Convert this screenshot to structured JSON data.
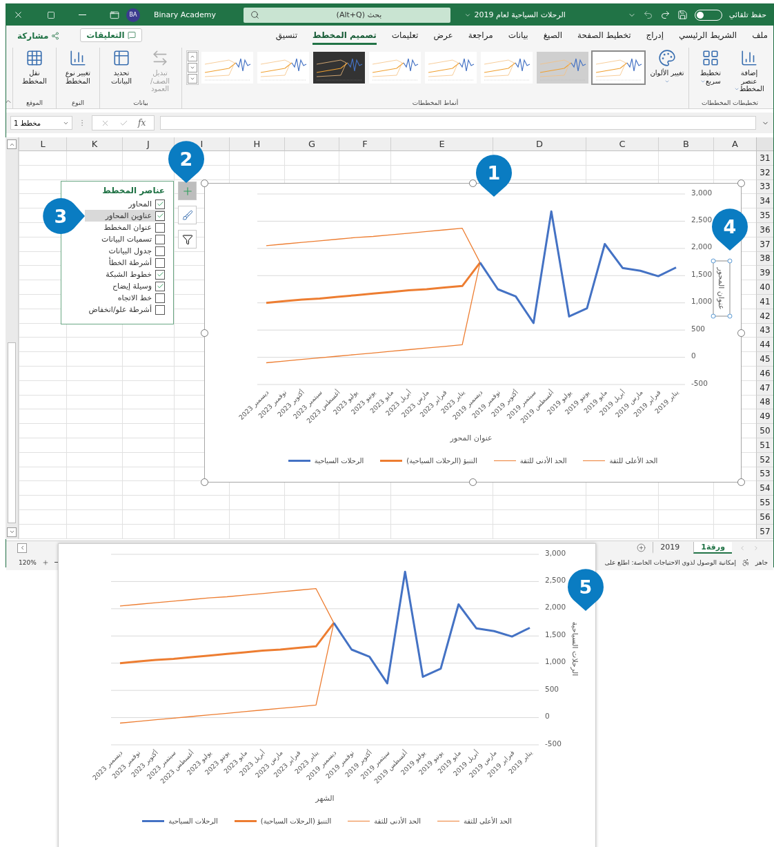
{
  "title_bar": {
    "autosave": {
      "label": "حفظ تلقائي",
      "on": false
    },
    "document_title": "الرحلات السياحية لعام 2019",
    "search": {
      "placeholder": "بحث (Alt+Q)"
    },
    "user": {
      "initials": "BA",
      "name": "Binary Academy"
    }
  },
  "ribbon_tabs": [
    {
      "label": "ملف",
      "selected": false
    },
    {
      "label": "الشريط الرئيسي",
      "selected": false
    },
    {
      "label": "إدراج",
      "selected": false
    },
    {
      "label": "تخطيط الصفحة",
      "selected": false
    },
    {
      "label": "الصيغ",
      "selected": false
    },
    {
      "label": "بيانات",
      "selected": false
    },
    {
      "label": "مراجعة",
      "selected": false
    },
    {
      "label": "عرض",
      "selected": false
    },
    {
      "label": "تعليمات",
      "selected": false
    },
    {
      "label": "تصميم المخطط",
      "selected": true
    },
    {
      "label": "تنسيق",
      "selected": false
    }
  ],
  "comments_button": "التعليقات",
  "share_button": "مشاركة",
  "ribbon_groups": [
    {
      "label": "تخطيطات المخططات",
      "buttons": [
        {
          "label": "إضافة عنصر المخطط",
          "kind": "add-element",
          "dropdown": true,
          "disabled": false
        },
        {
          "label": "تخطيط سريع",
          "kind": "quick-layout",
          "dropdown": true,
          "disabled": false
        }
      ]
    },
    {
      "label": "أنماط المخططات",
      "buttons": [
        {
          "label": "تغيير الألوان",
          "kind": "colors",
          "dropdown": true,
          "disabled": false
        }
      ],
      "styles": [
        {
          "kind": "light",
          "selected": true
        },
        {
          "kind": "gray",
          "selected": false
        },
        {
          "kind": "light",
          "selected": false
        },
        {
          "kind": "light",
          "selected": false
        },
        {
          "kind": "light",
          "selected": false
        },
        {
          "kind": "dark",
          "selected": false
        },
        {
          "kind": "light",
          "selected": false
        },
        {
          "kind": "light",
          "selected": false
        }
      ]
    },
    {
      "label": "بيانات",
      "buttons": [
        {
          "label": "تبديل الصف/ العمود",
          "kind": "switch",
          "dropdown": false,
          "disabled": true
        },
        {
          "label": "تحديد البيانات",
          "kind": "select-data",
          "dropdown": false,
          "disabled": false
        }
      ]
    },
    {
      "label": "النوع",
      "buttons": [
        {
          "label": "تغيير نوع المخطط",
          "kind": "change-type",
          "dropdown": false,
          "disabled": false
        }
      ]
    },
    {
      "label": "الموقع",
      "buttons": [
        {
          "label": "نقل المخطط",
          "kind": "move",
          "dropdown": false,
          "disabled": false
        }
      ]
    }
  ],
  "formula_bar": {
    "name_box": "مخطط 1",
    "fx_label": "fx"
  },
  "columns": [
    "A",
    "B",
    "C",
    "D",
    "E",
    "F",
    "G",
    "H",
    "I",
    "J",
    "K",
    "L"
  ],
  "rows": [
    "31",
    "32",
    "33",
    "34",
    "35",
    "36",
    "37",
    "38",
    "39",
    "40",
    "41",
    "42",
    "43",
    "44",
    "45",
    "46",
    "47",
    "48",
    "49",
    "50",
    "51",
    "52",
    "53",
    "54",
    "55",
    "56",
    "57"
  ],
  "sheet_tabs": [
    {
      "label": "ورقة1",
      "selected": true
    },
    {
      "label": "2019",
      "selected": false
    }
  ],
  "status_bar": {
    "ready": "جاهز",
    "accessibility": "إمكانية الوصول لذوي الاحتياجات الخاصة: اطلع على",
    "zoom": "120%"
  },
  "chart_elements": {
    "title": "عناصر المخطط",
    "items": [
      {
        "label": "المحاور",
        "checked": true,
        "selected": false
      },
      {
        "label": "عناوين المحاور",
        "checked": true,
        "selected": true
      },
      {
        "label": "عنوان المخطط",
        "checked": false,
        "selected": false
      },
      {
        "label": "تسميات البيانات",
        "checked": false,
        "selected": false
      },
      {
        "label": "جدول البيانات",
        "checked": false,
        "selected": false
      },
      {
        "label": "أشرطة الخطأ",
        "checked": false,
        "selected": false
      },
      {
        "label": "خطوط الشبكة",
        "checked": true,
        "selected": false
      },
      {
        "label": "وسيلة إيضاح",
        "checked": true,
        "selected": false
      },
      {
        "label": "خط الاتجاه",
        "checked": false,
        "selected": false
      },
      {
        "label": "أشرطة علو/انخفاض",
        "checked": false,
        "selected": false
      }
    ]
  },
  "chart_side_buttons": [
    {
      "kind": "plus",
      "selected": true
    },
    {
      "kind": "brush",
      "selected": false
    },
    {
      "kind": "filter",
      "selected": false
    }
  ],
  "chart": {
    "axis_title_selected": true,
    "line_styles": [
      {
        "kind": "bound"
      },
      {
        "kind": "bound"
      },
      {
        "kind": "main"
      },
      {
        "kind": "main"
      }
    ],
    "chart_data": {
      "type": "line",
      "xlabel": "عنوان المحور",
      "ylabel": "عنوان المحور",
      "grid": true,
      "legend": "bottom",
      "categories": [
        "ديسمبر 2023",
        "نوفمبر 2023",
        "أكتوبر 2023",
        "سبتمبر 2023",
        "أغسطس 2023",
        "يوليو 2023",
        "يونيو 2023",
        "مايو 2023",
        "أبريل 2023",
        "مارس 2023",
        "فبراير 2023",
        "يناير 2023",
        "ديسمبر 2019",
        "نوفمبر 2019",
        "أكتوبر 2019",
        "سبتمبر 2019",
        "أغسطس 2019",
        "يوليو 2019",
        "يونيو 2019",
        "مايو 2019",
        "أبريل 2019",
        "مارس 2019",
        "فبراير 2019",
        "يناير 2019"
      ],
      "series": [
        {
          "name": "الحد الأعلى للثقة",
          "color": "#ed7d31",
          "values": [
            2050,
            2080,
            2110,
            2140,
            2170,
            2200,
            2220,
            2250,
            2280,
            2310,
            2340,
            2370,
            1740,
            null,
            null,
            null,
            null,
            null,
            null,
            null,
            null,
            null,
            null,
            null
          ]
        },
        {
          "name": "الحد الأدنى للثقة",
          "color": "#ed7d31",
          "values": [
            -100,
            -70,
            -40,
            -10,
            20,
            50,
            80,
            110,
            140,
            170,
            200,
            230,
            1740,
            null,
            null,
            null,
            null,
            null,
            null,
            null,
            null,
            null,
            null,
            null
          ]
        },
        {
          "name": "التنبؤ (الرحلات السياحية)",
          "color": "#ed7d31",
          "values": [
            1000,
            1030,
            1060,
            1080,
            1110,
            1140,
            1170,
            1200,
            1230,
            1250,
            1280,
            1310,
            1740,
            null,
            null,
            null,
            null,
            null,
            null,
            null,
            null,
            null,
            null,
            null
          ]
        },
        {
          "name": "الرحلات السياحية",
          "color": "#4472c4",
          "values": [
            null,
            null,
            null,
            null,
            null,
            null,
            null,
            null,
            null,
            null,
            null,
            null,
            1740,
            1250,
            1120,
            630,
            2680,
            750,
            900,
            2080,
            1640,
            1590,
            1490,
            1650
          ]
        }
      ],
      "ylim": [
        -500,
        3000
      ],
      "yticks": [
        {
          "value": -500,
          "label": "-500"
        },
        {
          "value": 0,
          "label": "0"
        },
        {
          "value": 500,
          "label": "500"
        },
        {
          "value": 1000,
          "label": "1,000"
        },
        {
          "value": 1500,
          "label": "1,500"
        },
        {
          "value": 2000,
          "label": "2,000"
        },
        {
          "value": 2500,
          "label": "2,500"
        },
        {
          "value": 3000,
          "label": "3,000"
        }
      ]
    }
  },
  "inset_chart": {
    "axis_title_selected": false,
    "line_styles": [
      {
        "kind": "bound"
      },
      {
        "kind": "bound"
      },
      {
        "kind": "main"
      },
      {
        "kind": "main"
      }
    ],
    "chart_data": {
      "type": "line",
      "xlabel": "الشهر",
      "ylabel": "الرحلات السياحية",
      "grid": true,
      "legend": "bottom",
      "categories": [
        "ديسمبر 2023",
        "نوفمبر 2023",
        "أكتوبر 2023",
        "سبتمبر 2023",
        "أغسطس 2023",
        "يوليو 2023",
        "يونيو 2023",
        "مايو 2023",
        "أبريل 2023",
        "مارس 2023",
        "فبراير 2023",
        "يناير 2023",
        "ديسمبر 2019",
        "نوفمبر 2019",
        "أكتوبر 2019",
        "سبتمبر 2019",
        "أغسطس 2019",
        "يوليو 2019",
        "يونيو 2019",
        "مايو 2019",
        "أبريل 2019",
        "مارس 2019",
        "فبراير 2019",
        "يناير 2019"
      ],
      "series": [
        {
          "name": "الحد الأعلى للثقة",
          "color": "#ed7d31",
          "values": [
            2050,
            2080,
            2110,
            2140,
            2170,
            2200,
            2220,
            2250,
            2280,
            2310,
            2340,
            2370,
            1740,
            null,
            null,
            null,
            null,
            null,
            null,
            null,
            null,
            null,
            null,
            null
          ]
        },
        {
          "name": "الحد الأدنى للثقة",
          "color": "#ed7d31",
          "values": [
            -100,
            -70,
            -40,
            -10,
            20,
            50,
            80,
            110,
            140,
            170,
            200,
            230,
            1740,
            null,
            null,
            null,
            null,
            null,
            null,
            null,
            null,
            null,
            null,
            null
          ]
        },
        {
          "name": "التنبؤ (الرحلات السياحية)",
          "color": "#ed7d31",
          "values": [
            1000,
            1030,
            1060,
            1080,
            1110,
            1140,
            1170,
            1200,
            1230,
            1250,
            1280,
            1310,
            1740,
            null,
            null,
            null,
            null,
            null,
            null,
            null,
            null,
            null,
            null,
            null
          ]
        },
        {
          "name": "الرحلات السياحية",
          "color": "#4472c4",
          "values": [
            null,
            null,
            null,
            null,
            null,
            null,
            null,
            null,
            null,
            null,
            null,
            null,
            1740,
            1250,
            1120,
            630,
            2680,
            750,
            900,
            2080,
            1640,
            1590,
            1490,
            1650
          ]
        }
      ],
      "ylim": [
        -500,
        3000
      ],
      "yticks": [
        {
          "value": -500,
          "label": "-500"
        },
        {
          "value": 0,
          "label": "0"
        },
        {
          "value": 500,
          "label": "500"
        },
        {
          "value": 1000,
          "label": "1,000"
        },
        {
          "value": 1500,
          "label": "1,500"
        },
        {
          "value": 2000,
          "label": "2,000"
        },
        {
          "value": 2500,
          "label": "2,500"
        },
        {
          "value": 3000,
          "label": "3,000"
        }
      ]
    }
  },
  "callouts": [
    {
      "number": "1"
    },
    {
      "number": "2"
    },
    {
      "number": "3"
    },
    {
      "number": "4"
    },
    {
      "number": "5"
    }
  ]
}
